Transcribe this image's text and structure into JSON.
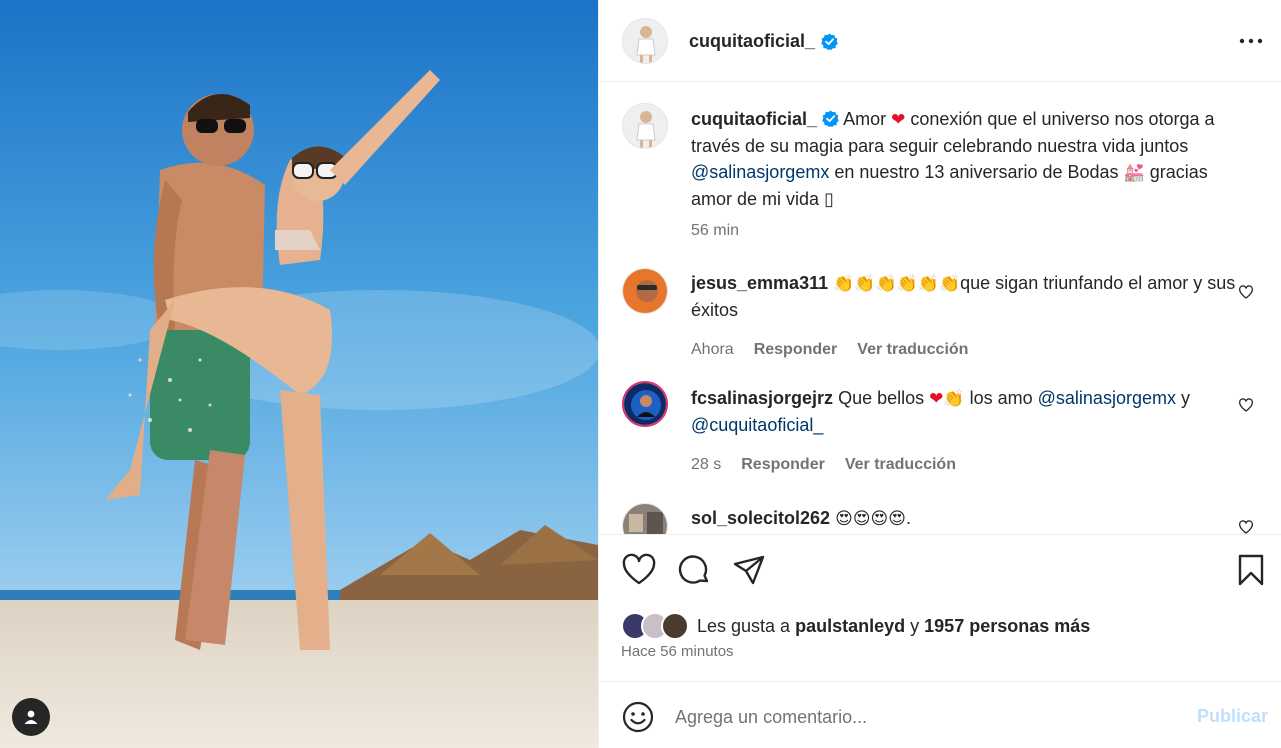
{
  "post": {
    "username": "cuquitaoficial_",
    "caption": {
      "text_1": "Amor",
      "text_2": "conexión que el universo nos otorga a través de su magia para seguir celebrando nuestra vida juntos",
      "mention": "@salinasjorgemx",
      "text_3": "en nuestro 13 aniversario de Bodas",
      "text_4": "gracias amor de mi vida",
      "time": "56 min"
    }
  },
  "comments": [
    {
      "username": "jesus_emma311",
      "emojis": "👏👏👏👏👏👏",
      "text": "que sigan triunfando el amor y sus éxitos",
      "time": "Ahora",
      "reply_label": "Responder",
      "translate_label": "Ver traducción"
    },
    {
      "username": "fcsalinasjorgejrz",
      "text_1": "Que bellos",
      "emoji_heart": "❤",
      "emoji_clap": "👏",
      "text_2": "los amo",
      "mention_1": "@salinasjorgemx",
      "text_3": "y",
      "mention_2": "@cuquitaoficial_",
      "time": "28 s",
      "reply_label": "Responder",
      "translate_label": "Ver traducción"
    },
    {
      "username": "sol_solecitol262",
      "emojis": "😍😍😍😍",
      "text": "."
    }
  ],
  "likes": {
    "prefix": "Les gusta a",
    "user": "paulstanleyd",
    "connector": "y",
    "others": "1957 personas más"
  },
  "time_ago": "Hace 56 minutos",
  "add_comment": {
    "placeholder": "Agrega un comentario...",
    "post_label": "Publicar"
  },
  "colors": {
    "link": "#00376b",
    "verified": "#0095f6",
    "muted": "#737373",
    "post_disabled": "#c0dffd"
  },
  "icons": [
    "verified-badge-icon",
    "more-options-icon",
    "heart-icon",
    "comment-icon",
    "share-icon",
    "bookmark-icon",
    "emoji-icon",
    "user-tag-icon"
  ]
}
